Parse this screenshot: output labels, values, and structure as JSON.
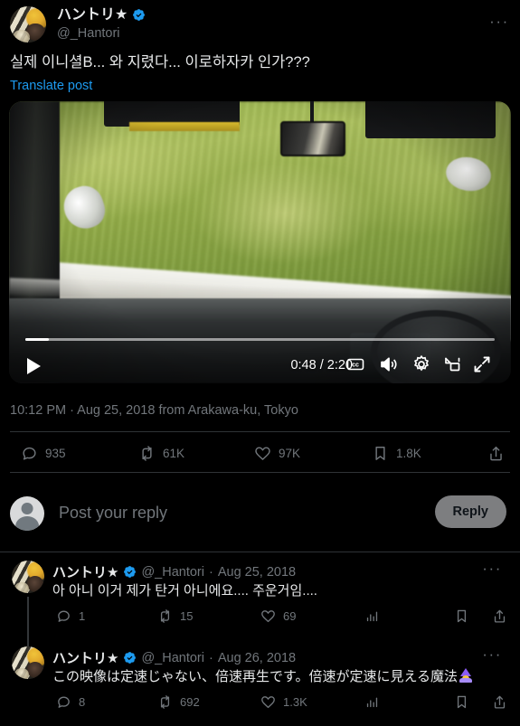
{
  "post": {
    "display_name": "ハントリ★",
    "verified": true,
    "handle": "@_Hantori",
    "more_glyph": "···",
    "text": "실제 이니셜B... 와 지렸다... 이로하자카 인가???",
    "translate_label": "Translate post",
    "meta": "10:12 PM · Aug 25, 2018 from Arakawa-ku, Tokyo",
    "stats": {
      "replies": "935",
      "reposts": "61K",
      "likes": "97K",
      "bookmarks": "1.8K"
    }
  },
  "video": {
    "current_time": "0:48",
    "duration": "2:20",
    "time_label": "0:48 / 2:20",
    "progress_percent": 5,
    "controls": [
      "play-icon",
      "cc-icon",
      "volume-icon",
      "settings-gear-icon",
      "picture-in-picture-icon",
      "fullscreen-icon"
    ]
  },
  "composer": {
    "placeholder": "Post your reply",
    "button_label": "Reply"
  },
  "replies": [
    {
      "display_name": "ハントリ★",
      "verified": true,
      "handle": "@_Hantori",
      "separator": "·",
      "date": "Aug 25, 2018",
      "more_glyph": "···",
      "text": "아 아니 이거 제가 탄거 아니에요.... 주운거임....",
      "stats": {
        "replies": "1",
        "reposts": "15",
        "likes": "69"
      }
    },
    {
      "display_name": "ハントリ★",
      "verified": true,
      "handle": "@_Hantori",
      "separator": "·",
      "date": "Aug 26, 2018",
      "more_glyph": "···",
      "text": "この映像は定速じゃない、倍速再生です。倍速が定速に見える魔法",
      "trailing_emoji": "mage-emoji",
      "stats": {
        "replies": "8",
        "reposts": "692",
        "likes": "1.3K"
      }
    }
  ],
  "colors": {
    "background": "#000000",
    "text_primary": "#e7e9ea",
    "text_secondary": "#71767b",
    "accent_blue": "#1d9bf0",
    "divider": "#2f3336",
    "reply_button": "#7d7e80"
  }
}
